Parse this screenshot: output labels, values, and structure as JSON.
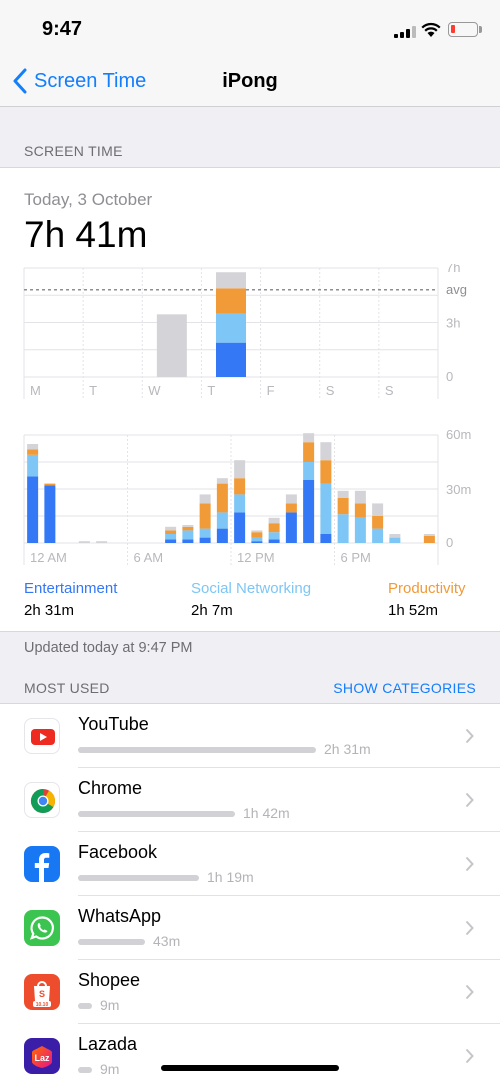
{
  "status": {
    "time": "9:47"
  },
  "nav": {
    "back_label": "Screen Time",
    "title": "iPong"
  },
  "screen_time": {
    "section_header": "SCREEN TIME",
    "date_label": "Today, 3 October",
    "total": "7h 41m"
  },
  "chart_data": [
    {
      "type": "bar",
      "stacked": true,
      "categories": [
        "M",
        "T",
        "W",
        "T",
        "F",
        "S",
        "S"
      ],
      "y_ticks": [
        "7h",
        "3h",
        "0"
      ],
      "avg_label": "avg",
      "ylim_hours": [
        0,
        8
      ],
      "avg_hours": 6.4,
      "series": [
        {
          "name": "Entertainment",
          "values": [
            0,
            0,
            0,
            2.52,
            0,
            0,
            0
          ]
        },
        {
          "name": "Social Networking",
          "values": [
            0,
            0,
            0,
            2.12,
            0,
            0,
            0
          ]
        },
        {
          "name": "Productivity",
          "values": [
            0,
            0,
            0,
            1.87,
            0,
            0,
            0
          ]
        },
        {
          "name": "Other",
          "values": [
            0,
            0,
            4.6,
            1.18,
            0,
            0,
            0
          ]
        }
      ]
    },
    {
      "type": "bar",
      "stacked": true,
      "x_labels": [
        "12 AM",
        "6 AM",
        "12 PM",
        "6 PM"
      ],
      "y_ticks": [
        "60m",
        "30m",
        "0"
      ],
      "ylim_minutes": [
        0,
        60
      ],
      "series": [
        {
          "name": "Entertainment",
          "values": [
            37,
            32,
            0,
            0,
            0,
            0,
            0,
            0,
            2,
            2,
            3,
            8,
            17,
            1,
            2,
            17,
            35,
            5,
            0,
            0,
            0,
            0,
            0,
            0
          ]
        },
        {
          "name": "Social Networking",
          "values": [
            12,
            0,
            0,
            0,
            0,
            0,
            0,
            0,
            3,
            5,
            5,
            9,
            10,
            2,
            4,
            0,
            10,
            28,
            16,
            14,
            8,
            3,
            0,
            0
          ]
        },
        {
          "name": "Productivity",
          "values": [
            3,
            1,
            0,
            0,
            0,
            0,
            0,
            0,
            2,
            2,
            14,
            16,
            9,
            3,
            5,
            5,
            11,
            13,
            9,
            8,
            7,
            0,
            0,
            4
          ]
        },
        {
          "name": "Other",
          "values": [
            3,
            0,
            0,
            1,
            1,
            0,
            0,
            0,
            2,
            1,
            5,
            3,
            10,
            1,
            3,
            5,
            5,
            10,
            4,
            7,
            7,
            2,
            0,
            1
          ]
        }
      ]
    }
  ],
  "colors": {
    "entertainment": "#3478f6",
    "social": "#7ec6f5",
    "productivity": "#f19a38",
    "other": "#d4d4d8",
    "accent": "#147efb"
  },
  "legend": [
    {
      "label": "Entertainment",
      "value": "2h 31m"
    },
    {
      "label": "Social Networking",
      "value": "2h 7m"
    },
    {
      "label": "Productivity",
      "value": "1h 52m"
    }
  ],
  "updated_text": "Updated today at 9:47 PM",
  "most_used": {
    "header": "MOST USED",
    "show_categories": "SHOW CATEGORIES",
    "apps": [
      {
        "name": "YouTube",
        "time": "2h 31m",
        "fraction": 1.0,
        "icon": "youtube-icon"
      },
      {
        "name": "Chrome",
        "time": "1h 42m",
        "fraction": 0.66,
        "icon": "chrome-icon"
      },
      {
        "name": "Facebook",
        "time": "1h 19m",
        "fraction": 0.51,
        "icon": "facebook-icon"
      },
      {
        "name": "WhatsApp",
        "time": "43m",
        "fraction": 0.28,
        "icon": "whatsapp-icon"
      },
      {
        "name": "Shopee",
        "time": "9m",
        "fraction": 0.06,
        "icon": "shopee-icon",
        "icon_text": "10.10"
      },
      {
        "name": "Lazada",
        "time": "9m",
        "fraction": 0.06,
        "icon": "lazada-icon",
        "icon_text": "Laz"
      }
    ]
  }
}
